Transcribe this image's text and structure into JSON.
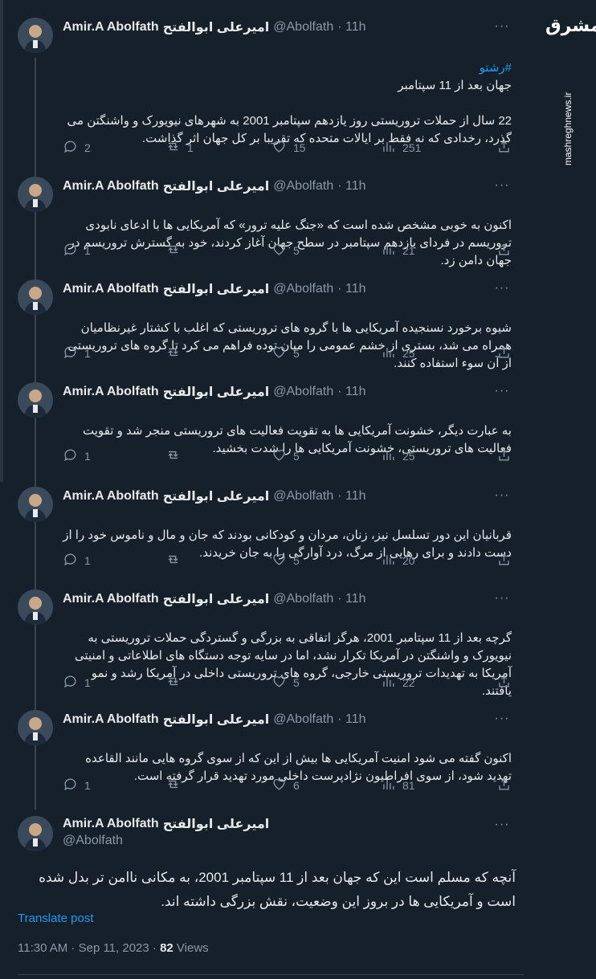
{
  "author": {
    "name": "Amir.A Abolfath",
    "name_fa": "امیرعلی ابوالفتح",
    "handle": "@Abolfath",
    "time": "11h"
  },
  "tweets": [
    {
      "hashtag": "#رشتو",
      "text": "جهان بعد از 11 سپتامبر\n\n22 سال از حملات تروریستی روز یازدهم سپتامبر 2001 به شهرهای نیویورک و واشنگتن می گذرد، رخدادی که نه فقط بر ایالات متحده که تقریبا بر کل جهان اثر گذاشت.",
      "replies": "2",
      "retweets": "1",
      "likes": "15",
      "views": "251"
    },
    {
      "hashtag": "",
      "text": "اکنون به خوبی مشخص شده است که «جنگ علیه ترور» که آمریکایی ها با ادعای نابودی تروریسم در فردای یازدهم سپتامبر در سطح جهان آغاز کردند، خود به گسترش تروریسم در جهان دامن زد.",
      "replies": "1",
      "retweets": "",
      "likes": "5",
      "views": "21"
    },
    {
      "hashtag": "",
      "text": "شیوه برخورد نسنجیده آمریکایی ها با گروه های تروریستی که اغلب با کشتار غیرنظامیان همراه می شد، بستری از خشم عمومی را میان توده فراهم می کرد تا گروه های تروریستی از آن سوء استفاده کنند.",
      "replies": "1",
      "retweets": "",
      "likes": "5",
      "views": "25"
    },
    {
      "hashtag": "",
      "text": "به عبارت دیگر، خشونت آمریکایی ها به تقویت فعالیت های تروریستی منجر شد و تقویت فعالیت های تروریستی، خشونت آمریکایی ها را شدت بخشید.",
      "replies": "1",
      "retweets": "",
      "likes": "5",
      "views": "25"
    },
    {
      "hashtag": "",
      "text": "قربانیان این دور تسلسل نیز، زنان، مردان و کودکانی بودند که جان و مال و ناموس خود را از دست دادند و برای رهایی از مرگ، درد آوارگی را به جان خریدند.",
      "replies": "1",
      "retweets": "",
      "likes": "5",
      "views": "20"
    },
    {
      "hashtag": "",
      "text": "گرچه بعد از 11 سپتامبر 2001، هرگز اتفاقی به بزرگی و گستردگی حملات تروریستی به نیویورک و واشنگتن در آمریکا تکرار نشد، اما در سایه توجه دستگاه های اطلاعاتی و امنیتی آمریکا به تهدیدات تروریستی خارجی، گروه های تروریستی داخلی در آمریکا رشد و نمو یافتند.",
      "replies": "1",
      "retweets": "",
      "likes": "5",
      "views": "22"
    },
    {
      "hashtag": "",
      "text": "اکنون گفته می شود امنیت آمریکایی ها بیش از این که از سوی گروه هایی مانند القاعده تهدید شود، از سوی افراطیون نژادپرست داخلی مورد تهدید قرار گرفته است.",
      "replies": "1",
      "retweets": "",
      "likes": "6",
      "views": "81"
    }
  ],
  "main_tweet": {
    "text": "آنچه که مسلم است این که جهان بعد از 11 سپتامبر 2001، به مکانی ناامن تر بدل شده است و آمریکایی ها در بروز این وضعیت، نقش بزرگی داشته اند.",
    "translate_label": "Translate post",
    "timestamp": "11:30 AM · Sep 11, 2023 · ",
    "views_count": "82",
    "views_label": " Views"
  },
  "watermark": {
    "logo": "مشرق",
    "url": "mashreghnews.ir"
  },
  "icons": {
    "reply": "reply-icon",
    "retweet": "retweet-icon",
    "like": "heart-icon",
    "views": "views-icon",
    "share": "share-icon"
  }
}
